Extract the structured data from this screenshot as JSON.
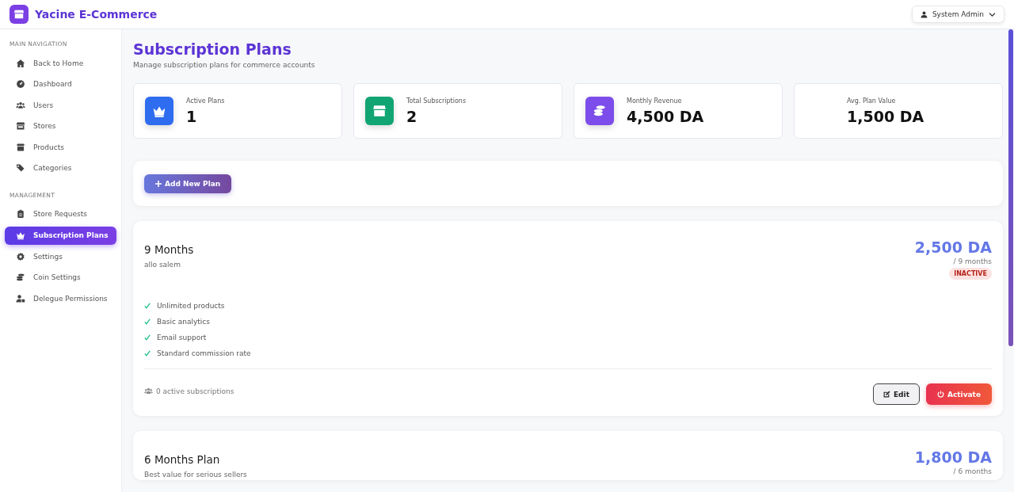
{
  "brand": {
    "name": "Yacine E-Commerce"
  },
  "user_menu": {
    "label": "System Admin"
  },
  "sidebar": {
    "sections": [
      {
        "title": "MAIN NAVIGATION",
        "items": [
          {
            "label": "Back to Home",
            "kind": "home",
            "selected": false
          },
          {
            "label": "Dashboard",
            "kind": "gauge",
            "selected": false
          },
          {
            "label": "Users",
            "kind": "users",
            "selected": false
          },
          {
            "label": "Stores",
            "kind": "store",
            "selected": false
          },
          {
            "label": "Products",
            "kind": "box",
            "selected": false
          },
          {
            "label": "Categories",
            "kind": "tags",
            "selected": false
          }
        ]
      },
      {
        "title": "MANAGEMENT",
        "items": [
          {
            "label": "Store Requests",
            "kind": "clipboard",
            "selected": false
          },
          {
            "label": "Subscription Plans",
            "kind": "crown",
            "selected": true
          },
          {
            "label": "Settings",
            "kind": "gear",
            "selected": false
          },
          {
            "label": "Coin Settings",
            "kind": "coins",
            "selected": false
          },
          {
            "label": "Delegue Permissions",
            "kind": "userlock",
            "selected": false
          }
        ]
      }
    ]
  },
  "page": {
    "title": "Subscription Plans",
    "subtitle": "Manage subscription plans for commerce accounts"
  },
  "stats": [
    {
      "label": "Active Plans",
      "value": "1",
      "kind": "crown",
      "color": "#2f6df0"
    },
    {
      "label": "Total Subscriptions",
      "value": "2",
      "kind": "store",
      "color": "#12a574"
    },
    {
      "label": "Monthly Revenue",
      "value": "4,500 DA",
      "kind": "coins",
      "color": "#7c4dea"
    },
    {
      "label": "Avg. Plan Value",
      "value": "1,500 DA"
    }
  ],
  "add_button": {
    "label": "Add New Plan"
  },
  "plans": [
    {
      "name": "9 Months",
      "description": "allo salem",
      "price": "2,500 DA",
      "period": "/ 9 months",
      "status": "INACTIVE",
      "features": [
        "Unlimited products",
        "Basic analytics",
        "Email support",
        "Standard commission rate"
      ],
      "subscriptions": "0 active subscriptions",
      "actions": [
        {
          "label": "Edit",
          "kind": "edit"
        },
        {
          "label": "Activate",
          "kind": "activate"
        }
      ]
    },
    {
      "name": "6 Months Plan",
      "description": "Best value for serious sellers",
      "price": "1,800 DA",
      "period": "/ 6 months"
    }
  ]
}
